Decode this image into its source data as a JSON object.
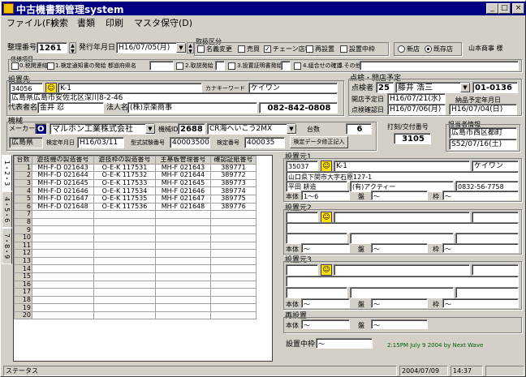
{
  "window": {
    "title": "中古機書類管理system",
    "min": "_",
    "max": "□",
    "close": "×"
  },
  "menu": [
    "ファイル(F)",
    "検索",
    "書類",
    "印刷",
    "マスタ保守(D)"
  ],
  "header": {
    "seiri_label": "整理番号",
    "seiri_value": "1261",
    "hakko_label": "発行年月日",
    "hakko_value": "H16/07/05(月)",
    "torihiki_label": "取扱区分",
    "torihiki": [
      {
        "label": "名義変更",
        "checked": false
      },
      {
        "label": "売買",
        "checked": false
      },
      {
        "label": "チェーン店移",
        "checked": true
      },
      {
        "label": "再設置",
        "checked": false
      },
      {
        "label": "設置中枠",
        "checked": false
      }
    ],
    "shinten": {
      "label": "新店",
      "selected": false
    },
    "kizon": {
      "label": "既存店",
      "selected": true
    },
    "company": "山本商事 様"
  },
  "renraku": {
    "title": "住様項目",
    "items": [
      {
        "label": "0.税関連絡",
        "value": ""
      },
      {
        "label": "1.検定通知書の発給 都道府県名",
        "value": ""
      },
      {
        "label": "2.取説発給",
        "value": ""
      },
      {
        "label": "3.設置証明書発給",
        "value": ""
      },
      {
        "label": "4.組合せの確認",
        "value": ""
      },
      {
        "label": "5.その他",
        "value": ""
      }
    ]
  },
  "setchi": {
    "title": "設置先",
    "code": "34056",
    "name": "K-1",
    "kana_label": "カナキーワード",
    "kana": "ケイワン",
    "address": "広島県広島市安佐北区深川8-2-46",
    "rep_label": "代表者名",
    "rep": "金井 忍",
    "corp_label": "法人名",
    "corp": "(株)京楽商事",
    "tel": "082-842-0808"
  },
  "tenken": {
    "title": "点検・開店予定",
    "person_label": "点検者",
    "person_no": "25",
    "person": "藤井 浩三",
    "person_tel": "01-0136",
    "open_label": "開店予定日",
    "open": "H16/07/21(水)",
    "confirm_label": "点検確認日",
    "confirm": "H16/07/06(月)",
    "nouhin_label": "納品予定年月日",
    "nouhin": "H16/07/04(日)"
  },
  "kishu": {
    "title": "機械",
    "maker_label": "メーカー",
    "maker_code": "O",
    "maker": "マルホン工業株式会社",
    "kishu_label": "機械ID",
    "kishu_no": "2688",
    "kishu_name": "CR海へいこう2MX",
    "daisu_label": "台数",
    "daisu": "6",
    "pref": "広島県",
    "kentei_label": "検定年月日",
    "kentei": "H16/03/11",
    "kata_label": "型式試験番号",
    "kata": "40003500",
    "kentei_no_label": "検定番号",
    "kentei_no": "400035",
    "fix_button": "検定データ修正記入"
  },
  "dakoku": {
    "title": "打刻/交付番号",
    "value": "3105"
  },
  "tanto": {
    "title": "担当者情報",
    "area": "広島市西区都町",
    "date": "S52/07/16(土)"
  },
  "vtabs": [
    "1・2・3",
    "4・5・6",
    "7・8・9"
  ],
  "grid": {
    "headers": [
      "台数",
      "遊技機の製造番号",
      "遊技枠の製造番号",
      "主基板管理番号",
      "確認証紙番号"
    ],
    "rows": [
      [
        "1",
        "MH-F-D 021643",
        "O-E-K 117531",
        "MH-F 021643",
        "389771"
      ],
      [
        "2",
        "MH-F-D 021644",
        "O-E-K 117532",
        "MH-F 021644",
        "389772"
      ],
      [
        "3",
        "MH-F-D 021645",
        "O-E-K 117533",
        "MH-F 021645",
        "389773"
      ],
      [
        "4",
        "MH-F-D 021646",
        "O-E-K 117534",
        "MH-F 021646",
        "389774"
      ],
      [
        "5",
        "MH-F-D 021647",
        "O-E-K 117535",
        "MH-F 021647",
        "389775"
      ],
      [
        "6",
        "MH-F-D 021648",
        "O-E-K 117536",
        "MH-F 021648",
        "389776"
      ],
      [
        "7",
        "",
        "",
        "",
        ""
      ],
      [
        "8",
        "",
        "",
        "",
        ""
      ],
      [
        "9",
        "",
        "",
        "",
        ""
      ],
      [
        "10",
        "",
        "",
        "",
        ""
      ],
      [
        "11",
        "",
        "",
        "",
        ""
      ],
      [
        "12",
        "",
        "",
        "",
        ""
      ],
      [
        "13",
        "",
        "",
        "",
        ""
      ],
      [
        "14",
        "",
        "",
        "",
        ""
      ],
      [
        "15",
        "",
        "",
        "",
        ""
      ],
      [
        "16",
        "",
        "",
        "",
        ""
      ],
      [
        "17",
        "",
        "",
        "",
        ""
      ],
      [
        "18",
        "",
        "",
        "",
        ""
      ],
      [
        "19",
        "",
        "",
        "",
        ""
      ],
      [
        "20",
        "",
        "",
        "",
        ""
      ]
    ]
  },
  "moto1": {
    "title": "設置元1",
    "code": "35037",
    "name": "K-1",
    "kana": "ケイワン",
    "address": "山口県下関市大字石原127-1",
    "rep": "平田 耕造",
    "corp": "(有)アクティー",
    "tel": "0832-56-7758",
    "hontai_label": "本体",
    "hontai": "1～6",
    "ban_label": "盤",
    "ban": "～",
    "waku_label": "枠",
    "waku": "～"
  },
  "moto2": {
    "title": "設置元2",
    "hontai_label": "本体",
    "hontai": "～",
    "ban_label": "盤",
    "ban": "～",
    "waku_label": "枠",
    "waku": "～"
  },
  "moto3": {
    "title": "設置元3",
    "hontai_label": "本体",
    "hontai": "～",
    "ban_label": "盤",
    "ban": "～",
    "waku_label": "枠",
    "waku": "～"
  },
  "resetchi": {
    "title": "再設置",
    "hontai_label": "本体",
    "hontai": "～",
    "ban_label": "盤",
    "ban": "～"
  },
  "chuwaku": {
    "label": "設置中枠",
    "value": "～"
  },
  "credit": "2:15PM July 9 2004 by Next Wave",
  "status": {
    "text": "ステータス",
    "date": "2004/07/09",
    "time": "14:37"
  }
}
